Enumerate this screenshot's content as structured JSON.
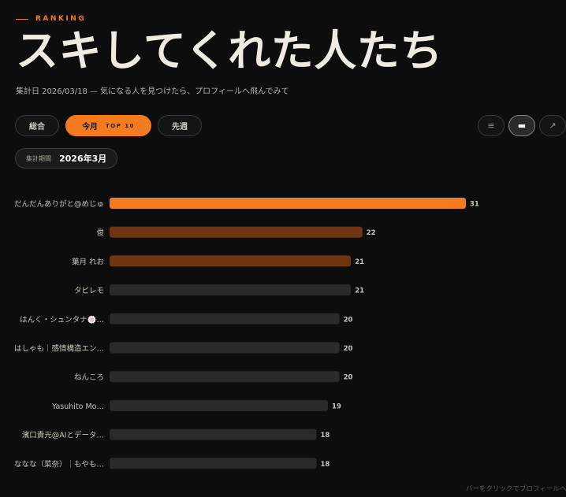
{
  "header": {
    "eyebrow": "RANKING",
    "title": "スキしてくれた人たち",
    "subtitle": "集計日 2026/03/18 — 気になる人を見つけたら、プロフィールへ飛んでみて"
  },
  "tabs": [
    {
      "label": "総合",
      "active": false
    },
    {
      "label": "今月",
      "badge": "TOP 10",
      "active": true
    },
    {
      "label": "先週",
      "active": false
    }
  ],
  "view_buttons": [
    {
      "icon": "list-icon",
      "glyph": "≡",
      "active": false
    },
    {
      "icon": "bar-chart-icon",
      "glyph": "▬",
      "active": true
    },
    {
      "icon": "trend-arrow-icon",
      "glyph": "↗",
      "active": false
    }
  ],
  "period": {
    "label": "集計期間",
    "value": "2026年3月"
  },
  "colors": {
    "accent": "#f47b20",
    "accent_dark": "#6e3510",
    "bar_muted": "#2a2a2a",
    "background": "#0d0d0d"
  },
  "chart_data": {
    "type": "bar",
    "orientation": "horizontal",
    "categories": [
      "だんだんありがと@めじゅ",
      "俊",
      "葉月 れお",
      "タビレモ",
      "はんく・シュンタナ🍥…",
      "はしゃも｜感情構造エン…",
      "ねんころ",
      "Yasuhito Mo…",
      "濱口貴光@AIとデータ…",
      "ななな（菜奈）｜もやも…"
    ],
    "values": [
      31,
      22,
      21,
      21,
      20,
      20,
      20,
      19,
      18,
      18
    ],
    "rank_tier": [
      "first",
      "top3",
      "top3",
      "other",
      "other",
      "other",
      "other",
      "other",
      "other",
      "other"
    ]
  },
  "footer_hint": "バーをクリックでプロフィールへ"
}
